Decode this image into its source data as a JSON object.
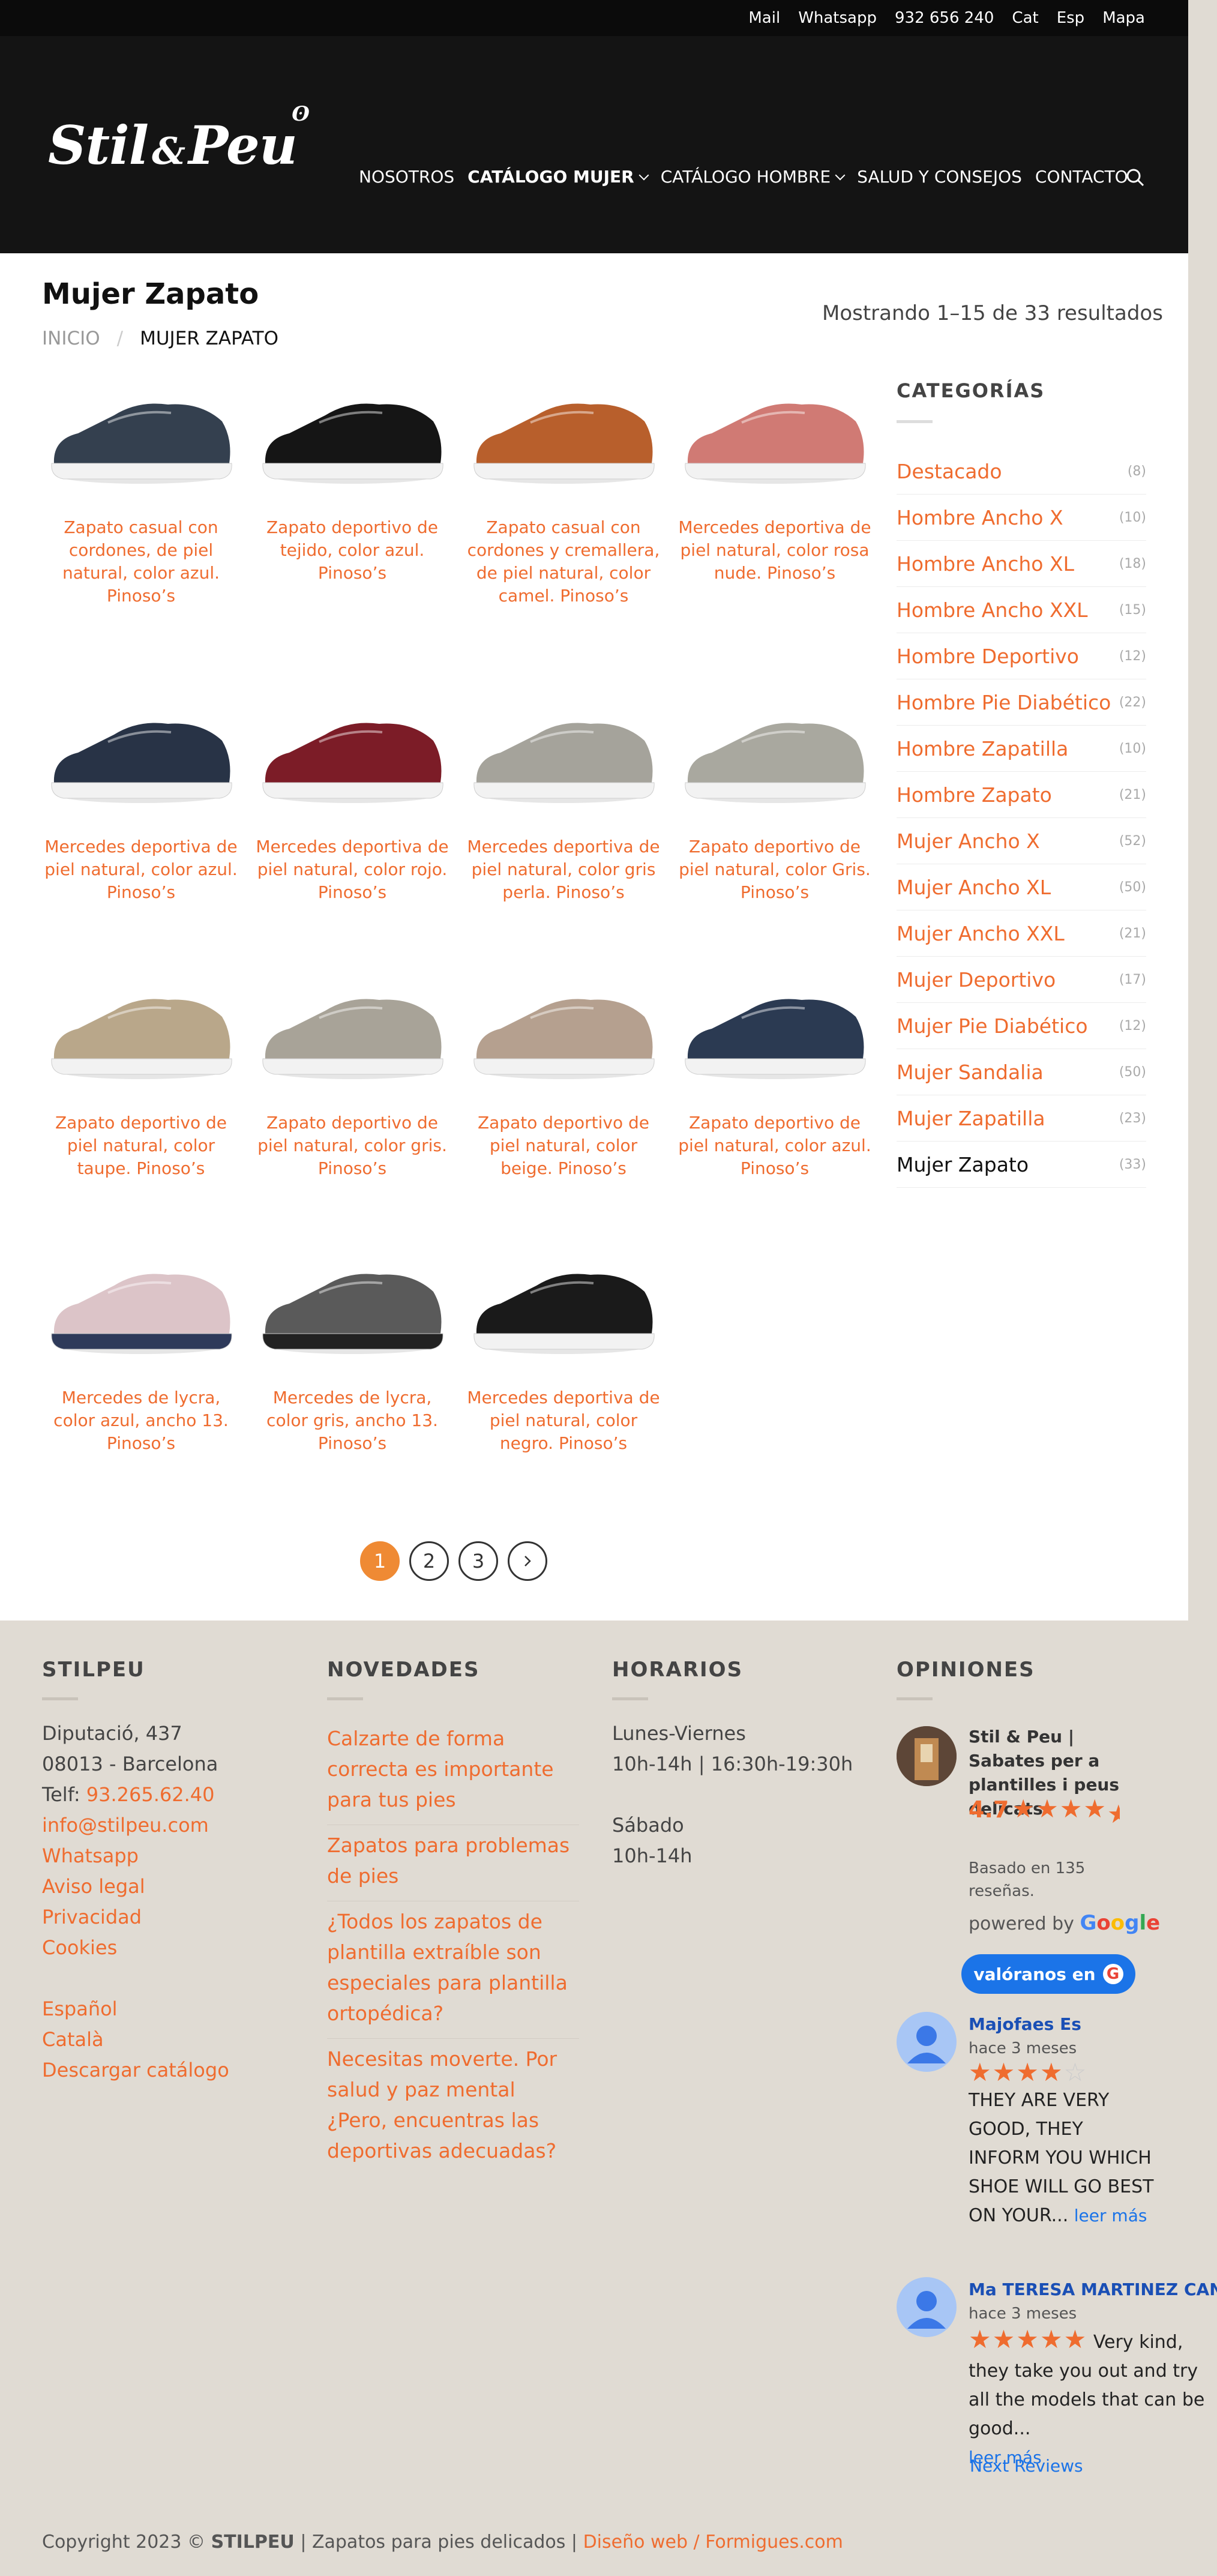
{
  "topbar": {
    "items": [
      "Mail",
      "Whatsapp",
      "932 656 240",
      "Cat",
      "Esp",
      "Mapa"
    ]
  },
  "brand": {
    "logo_text": "Stil & Peu"
  },
  "nav": {
    "items": [
      {
        "label": "NOSOTROS"
      },
      {
        "label": "CATÁLOGO MUJER"
      },
      {
        "label": "CATÁLOGO HOMBRE"
      },
      {
        "label": "SALUD Y CONSEJOS"
      },
      {
        "label": "CONTACTO"
      }
    ]
  },
  "page": {
    "title": "Mujer Zapato",
    "results": "Mostrando 1–15 de 33 resultados"
  },
  "breadcrumb": {
    "home": "INICIO",
    "current": "MUJER ZAPATO"
  },
  "products": [
    {
      "title": "Zapato casual con cordones, de piel natural, color azul. Pinoso’s",
      "color": "#34404f",
      "sole": "#f2f2f2"
    },
    {
      "title": "Zapato deportivo de tejido, color azul. Pinoso’s",
      "color": "#151515",
      "sole": "#f2f2f2"
    },
    {
      "title": "Zapato casual con cordones y cremallera, de piel natural, color camel. Pinoso’s",
      "color": "#b85f2c",
      "sole": "#f2f2f2"
    },
    {
      "title": "Mercedes deportiva de piel natural, color rosa nude. Pinoso’s",
      "color": "#d07a74",
      "sole": "#f2f2f2"
    },
    {
      "title": "Mercedes deportiva de piel natural, color azul. Pinoso’s",
      "color": "#283346",
      "sole": "#f2f2f2"
    },
    {
      "title": "Mercedes deportiva de piel natural, color rojo. Pinoso’s",
      "color": "#7c1c27",
      "sole": "#f2f2f2"
    },
    {
      "title": "Mercedes deportiva de piel natural, color gris perla. Pinoso’s",
      "color": "#a5a39b",
      "sole": "#f2f2f2"
    },
    {
      "title": "Zapato deportivo de piel natural, color Gris. Pinoso’s",
      "color": "#a9a89f",
      "sole": "#f2f2f2"
    },
    {
      "title": "Zapato deportivo de piel natural, color taupe. Pinoso’s",
      "color": "#b9a78a",
      "sole": "#f2f2f2"
    },
    {
      "title": "Zapato deportivo de piel natural, color gris. Pinoso’s",
      "color": "#a8a398",
      "sole": "#f2f2f2"
    },
    {
      "title": "Zapato deportivo de piel natural, color beige. Pinoso’s",
      "color": "#b5a08f",
      "sole": "#f2f2f2"
    },
    {
      "title": "Zapato deportivo de piel natural, color azul. Pinoso’s",
      "color": "#2b3a52",
      "sole": "#f2f2f2"
    },
    {
      "title": "Mercedes de lycra, color azul, ancho 13. Pinoso’s",
      "color": "#dcc4c8",
      "sole": "#2e3a5a"
    },
    {
      "title": "Mercedes de lycra, color gris, ancho 13. Pinoso’s",
      "color": "#5a5a5a",
      "sole": "#222222"
    },
    {
      "title": "Mercedes deportiva de piel natural, color negro. Pinoso’s",
      "color": "#1a1a1a",
      "sole": "#f2f2f2"
    }
  ],
  "pagination": {
    "pages": [
      "1",
      "2",
      "3"
    ],
    "current": "1"
  },
  "sidebar": {
    "title": "CATEGORÍAS",
    "categories": [
      {
        "name": "Destacado",
        "count": "(8)"
      },
      {
        "name": "Hombre Ancho X",
        "count": "(10)"
      },
      {
        "name": "Hombre Ancho XL",
        "count": "(18)"
      },
      {
        "name": "Hombre Ancho XXL",
        "count": "(15)"
      },
      {
        "name": "Hombre Deportivo",
        "count": "(12)"
      },
      {
        "name": "Hombre Pie Diabético",
        "count": "(22)"
      },
      {
        "name": "Hombre Zapatilla",
        "count": "(10)"
      },
      {
        "name": "Hombre Zapato",
        "count": "(21)"
      },
      {
        "name": "Mujer Ancho X",
        "count": "(52)"
      },
      {
        "name": "Mujer Ancho XL",
        "count": "(50)"
      },
      {
        "name": "Mujer Ancho XXL",
        "count": "(21)"
      },
      {
        "name": "Mujer Deportivo",
        "count": "(17)"
      },
      {
        "name": "Mujer Pie Diabético",
        "count": "(12)"
      },
      {
        "name": "Mujer Sandalia",
        "count": "(50)"
      },
      {
        "name": "Mujer Zapatilla",
        "count": "(23)"
      },
      {
        "name": "Mujer Zapato",
        "count": "(33)"
      }
    ]
  },
  "footer": {
    "stilpeu": {
      "title": "STILPEU",
      "address1": "Diputació, 437",
      "address2": "08013 - Barcelona",
      "tel_label": "Telf:",
      "tel": "93.265.62.40",
      "email": "info@stilpeu.com",
      "links": [
        "Whatsapp",
        "Aviso legal",
        "Privacidad",
        "Cookies"
      ],
      "lang_links": [
        "Español",
        "Català",
        "Descargar catálogo"
      ]
    },
    "novedades": {
      "title": "NOVEDADES",
      "items": [
        "Calzarte de forma correcta es importante para tus pies",
        "Zapatos para problemas de pies",
        "¿Todos los zapatos de plantilla extraíble son especiales para plantilla ortopédica?",
        "Necesitas moverte. Por salud y paz mental ¿Pero, encuentras las deportivas adecuadas?"
      ]
    },
    "horarios": {
      "title": "HORARIOS",
      "weekdays": "Lunes-Viernes",
      "weekday_hours": "10h-14h | 16:30h-19:30h",
      "saturday": "Sábado",
      "saturday_hours": "10h-14h"
    },
    "opiniones": {
      "title": "OPINIONES",
      "business": "Stil & Peu | Sabates per a plantilles i peus delicats",
      "rating": "4.7",
      "rating_value": 4.5,
      "based_on": "Basado en 135 reseñas.",
      "powered_by": "powered by",
      "google": "Google",
      "button": "valóranos en",
      "reviews": [
        {
          "name": "Majofaes Es",
          "time": "hace 3 meses",
          "stars": 4,
          "text": "THEY ARE VERY GOOD, THEY INFORM YOU WHICH SHOE WILL GO BEST ON YOUR...",
          "more": "leer más"
        },
        {
          "name": "Ma TERESA MARTINEZ CANO",
          "time": "hace 3 meses",
          "stars": 5,
          "text": "Very kind, they take you out and try all the models that can be good...",
          "more": "leer más"
        }
      ],
      "next": "Next Reviews"
    },
    "copyright": {
      "pre": "Copyright 2023 ©",
      "brand": "STILPEU",
      "mid": "| Zapatos para pies delicados |",
      "link": "Diseño web / Formigues.com"
    }
  },
  "colors": {
    "accent": "#ef6c2f",
    "header": "#141414",
    "topbar": "#0b0b0b",
    "footer": "#e0dbd3",
    "review_blue": "#1a4fb5"
  }
}
